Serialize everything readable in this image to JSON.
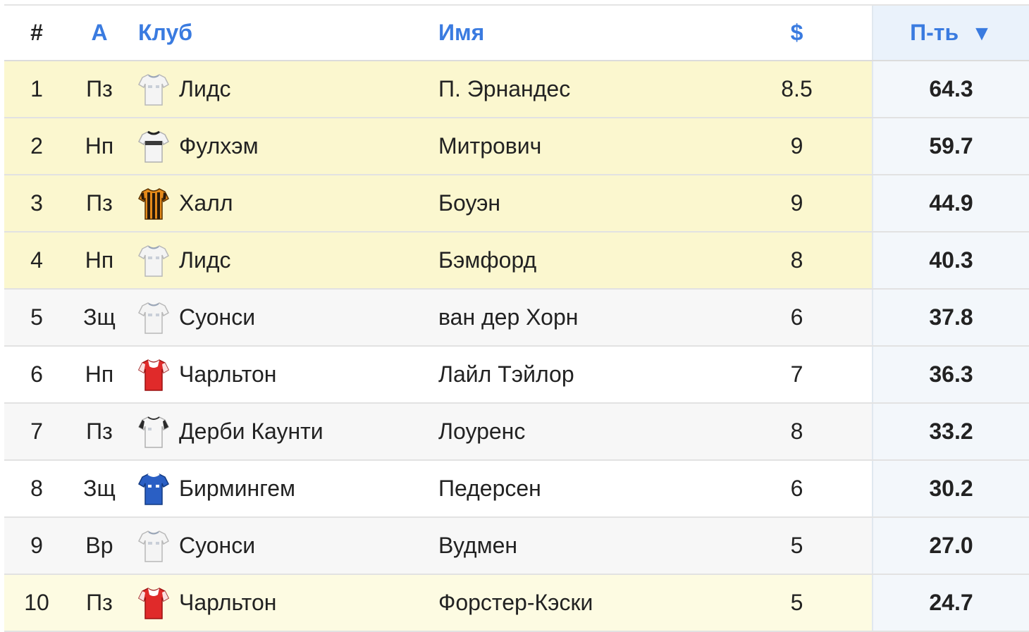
{
  "header": {
    "rank": "#",
    "pos": "А",
    "club": "Клуб",
    "name": "Имя",
    "price": "$",
    "points": "П-ть",
    "sort_indicator": "▼"
  },
  "colors": {
    "header_link": "#3a7be0",
    "highlight_row": "#fbf7cf",
    "points_column": "#eaf2fb"
  },
  "rows": [
    {
      "rank": "1",
      "pos": "Пз",
      "club": "Лидс",
      "shirt_icon": "leeds-shirt-icon",
      "name": "П. Эрнандес",
      "price": "8.5",
      "points": "64.3"
    },
    {
      "rank": "2",
      "pos": "Нп",
      "club": "Фулхэм",
      "shirt_icon": "fulham-shirt-icon",
      "name": "Митрович",
      "price": "9",
      "points": "59.7"
    },
    {
      "rank": "3",
      "pos": "Пз",
      "club": "Халл",
      "shirt_icon": "hull-shirt-icon",
      "name": "Боуэн",
      "price": "9",
      "points": "44.9"
    },
    {
      "rank": "4",
      "pos": "Нп",
      "club": "Лидс",
      "shirt_icon": "leeds-shirt-icon",
      "name": "Бэмфорд",
      "price": "8",
      "points": "40.3"
    },
    {
      "rank": "5",
      "pos": "Зщ",
      "club": "Суонси",
      "shirt_icon": "swansea-shirt-icon",
      "name": "ван дер Хорн",
      "price": "6",
      "points": "37.8"
    },
    {
      "rank": "6",
      "pos": "Нп",
      "club": "Чарльтон",
      "shirt_icon": "charlton-shirt-icon",
      "name": "Лайл Тэйлор",
      "price": "7",
      "points": "36.3"
    },
    {
      "rank": "7",
      "pos": "Пз",
      "club": "Дерби Каунти",
      "shirt_icon": "derby-shirt-icon",
      "name": "Лоуренс",
      "price": "8",
      "points": "33.2"
    },
    {
      "rank": "8",
      "pos": "Зщ",
      "club": "Бирмингем",
      "shirt_icon": "birmingham-shirt-icon",
      "name": "Педерсен",
      "price": "6",
      "points": "30.2"
    },
    {
      "rank": "9",
      "pos": "Вр",
      "club": "Суонси",
      "shirt_icon": "swansea-shirt-icon",
      "name": "Вудмен",
      "price": "5",
      "points": "27.0"
    },
    {
      "rank": "10",
      "pos": "Пз",
      "club": "Чарльтон",
      "shirt_icon": "charlton-shirt-icon",
      "name": "Форстер-Кэски",
      "price": "5",
      "points": "24.7"
    }
  ]
}
